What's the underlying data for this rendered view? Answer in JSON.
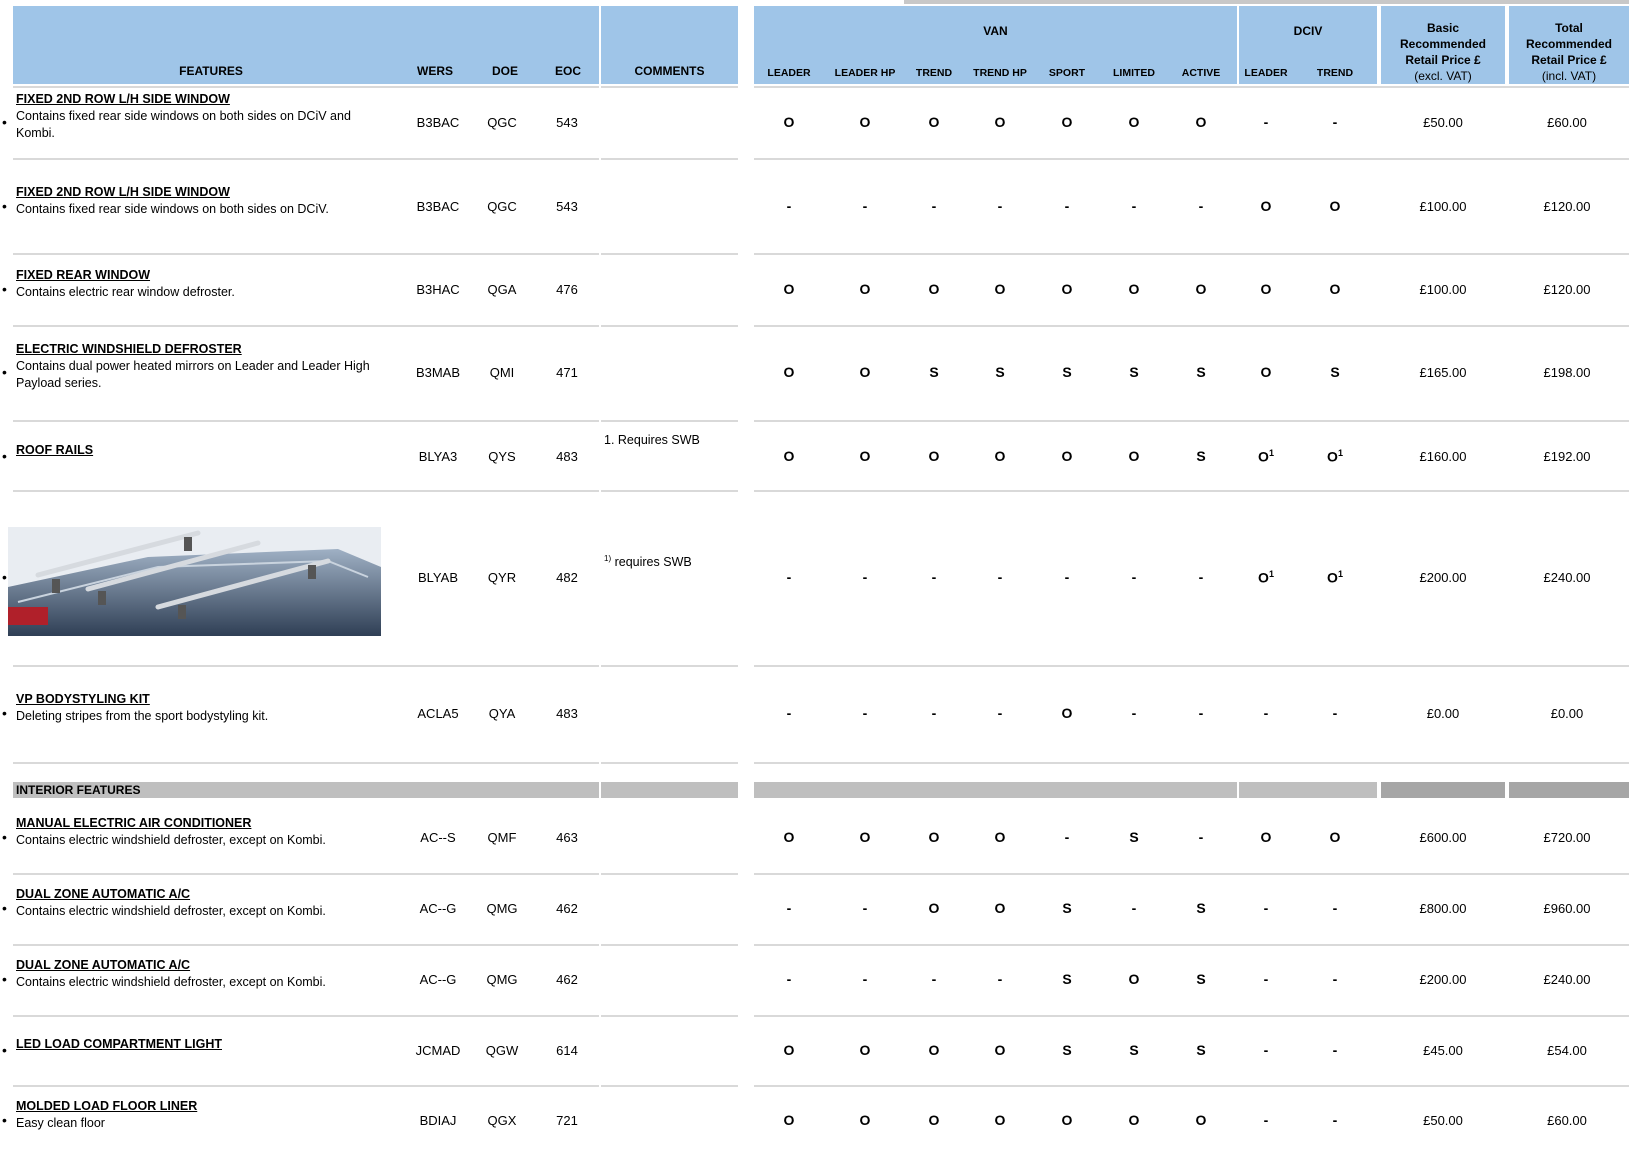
{
  "header": {
    "features": "FEATURES",
    "wers": "WERS",
    "doe": "DOE",
    "eoc": "EOC",
    "comments": "COMMENTS",
    "van": "VAN",
    "dciv": "DCIV",
    "van_cols": [
      "LEADER",
      "LEADER HP",
      "TREND",
      "TREND HP",
      "SPORT",
      "LIMITED",
      "ACTIVE"
    ],
    "dciv_cols": [
      "LEADER",
      "TREND"
    ],
    "basic_price": {
      "line1": "Basic",
      "line2": "Recommended",
      "line3": "Retail Price £",
      "line4": "(excl. VAT)"
    },
    "total_price": {
      "line1": "Total",
      "line2": "Recommended",
      "line3": "Retail Price £",
      "line4": "(incl. VAT)"
    }
  },
  "section_interior": "INTERIOR FEATURES",
  "rows": [
    {
      "title": "FIXED 2ND ROW L/H SIDE WINDOW",
      "desc1": "Contains fixed rear side windows on both sides on DCiV and",
      "desc2": "Kombi.",
      "wers": "B3BAC",
      "doe": "QGC",
      "eoc": "543",
      "comment": "",
      "marks": [
        "O",
        "O",
        "O",
        "O",
        "O",
        "O",
        "O",
        "-",
        "-"
      ],
      "basic": "£50.00",
      "total": "£60.00"
    },
    {
      "title": "FIXED 2ND ROW L/H SIDE WINDOW",
      "desc1": "Contains fixed rear side windows on both sides on DCiV.",
      "desc2": "",
      "wers": "B3BAC",
      "doe": "QGC",
      "eoc": "543",
      "comment": "",
      "marks": [
        "-",
        "-",
        "-",
        "-",
        "-",
        "-",
        "-",
        "O",
        "O"
      ],
      "basic": "£100.00",
      "total": "£120.00"
    },
    {
      "title": "FIXED REAR WINDOW",
      "desc1": "Contains electric rear window defroster.",
      "desc2": "",
      "wers": "B3HAC",
      "doe": "QGA",
      "eoc": "476",
      "comment": "",
      "marks": [
        "O",
        "O",
        "O",
        "O",
        "O",
        "O",
        "O",
        "O",
        "O"
      ],
      "basic": "£100.00",
      "total": "£120.00"
    },
    {
      "title": "ELECTRIC WINDSHIELD DEFROSTER",
      "desc1": "Contains dual power heated mirrors on Leader and Leader High",
      "desc2": "Payload series.",
      "wers": "B3MAB",
      "doe": "QMI",
      "eoc": "471",
      "comment": "",
      "marks": [
        "O",
        "O",
        "S",
        "S",
        "S",
        "S",
        "S",
        "O",
        "S"
      ],
      "basic": "£165.00",
      "total": "£198.00"
    },
    {
      "title": "ROOF RAILS",
      "desc1": "",
      "desc2": "",
      "wers": "BLYA3",
      "doe": "QYS",
      "eoc": "483",
      "comment": "1. Requires SWB",
      "marks": [
        "O",
        "O",
        "O",
        "O",
        "O",
        "O",
        "S",
        "O",
        "O"
      ],
      "sup": [
        "",
        "",
        "",
        "",
        "",
        "",
        "",
        "1",
        "1"
      ],
      "basic": "£160.00",
      "total": "£192.00"
    },
    {
      "title": "",
      "desc1": "",
      "desc2": "",
      "wers": "BLYAB",
      "doe": "QYR",
      "eoc": "482",
      "comment_sup": "1)",
      "comment": " requires SWB",
      "marks": [
        "-",
        "-",
        "-",
        "-",
        "-",
        "-",
        "-",
        "O",
        "O"
      ],
      "sup": [
        "",
        "",
        "",
        "",
        "",
        "",
        "",
        "1",
        "1"
      ],
      "basic": "£200.00",
      "total": "£240.00"
    },
    {
      "title": "VP BODYSTYLING KIT",
      "desc1": "Deleting stripes from the sport bodystyling kit.",
      "desc2": "",
      "wers": "ACLA5",
      "doe": "QYA",
      "eoc": "483",
      "comment": "",
      "marks": [
        "-",
        "-",
        "-",
        "-",
        "O",
        "-",
        "-",
        "-",
        "-"
      ],
      "basic": "£0.00",
      "total": "£0.00"
    },
    {
      "title": "MANUAL ELECTRIC AIR CONDITIONER",
      "desc1": "Contains electric windshield defroster, except on Kombi.",
      "desc2": "",
      "wers": "AC--S",
      "doe": "QMF",
      "eoc": "463",
      "comment": "",
      "marks": [
        "O",
        "O",
        "O",
        "O",
        "-",
        "S",
        "-",
        "O",
        "O"
      ],
      "basic": "£600.00",
      "total": "£720.00"
    },
    {
      "title": "DUAL ZONE AUTOMATIC A/C",
      "desc1": "Contains electric windshield defroster, except on Kombi.",
      "desc2": "",
      "wers": "AC--G",
      "doe": "QMG",
      "eoc": "462",
      "comment": "",
      "marks": [
        "-",
        "-",
        "O",
        "O",
        "S",
        "-",
        "S",
        "-",
        "-"
      ],
      "basic": "£800.00",
      "total": "£960.00"
    },
    {
      "title": "DUAL ZONE AUTOMATIC A/C",
      "desc1": "Contains electric windshield defroster, except on Kombi.",
      "desc2": "",
      "wers": "AC--G",
      "doe": "QMG",
      "eoc": "462",
      "comment": "",
      "marks": [
        "-",
        "-",
        "-",
        "-",
        "S",
        "O",
        "S",
        "-",
        "-"
      ],
      "basic": "£200.00",
      "total": "£240.00"
    },
    {
      "title": "LED LOAD COMPARTMENT LIGHT",
      "desc1": "",
      "desc2": "",
      "wers": "JCMAD",
      "doe": "QGW",
      "eoc": "614",
      "comment": "",
      "marks": [
        "O",
        "O",
        "O",
        "O",
        "S",
        "S",
        "S",
        "-",
        "-"
      ],
      "basic": "£45.00",
      "total": "£54.00"
    },
    {
      "title": "MOLDED LOAD FLOOR LINER",
      "desc1": "Easy clean floor",
      "desc2": "",
      "wers": "BDIAJ",
      "doe": "QGX",
      "eoc": "721",
      "comment": "",
      "marks": [
        "O",
        "O",
        "O",
        "O",
        "O",
        "O",
        "O",
        "-",
        "-"
      ],
      "basic": "£50.00",
      "total": "£60.00"
    }
  ],
  "colors": {
    "header": "#9fc5e8",
    "section_gray": "#bfbfbf",
    "separator": "#d9d9d9"
  }
}
